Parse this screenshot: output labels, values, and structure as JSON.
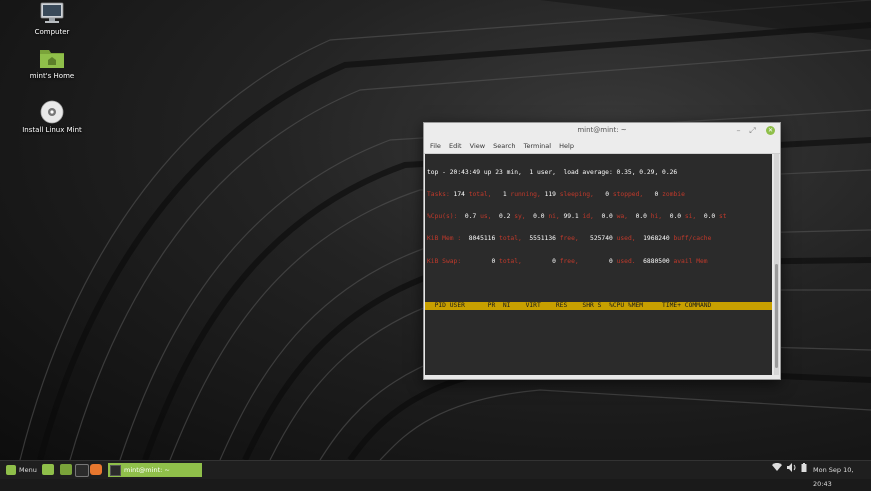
{
  "desktop": {
    "icons": [
      {
        "label": "Computer"
      },
      {
        "label": "mint's Home"
      },
      {
        "label": "Install Linux Mint"
      }
    ]
  },
  "window": {
    "title": "mint@mint: ~",
    "menu": [
      "File",
      "Edit",
      "View",
      "Search",
      "Terminal",
      "Help"
    ]
  },
  "terminal": {
    "line1": "top - 20:43:49 up 23 min,  1 user,  load average: 0.35, 0.29, 0.26",
    "tasks_total": "174",
    "tasks_running": "1",
    "tasks_sleeping": "119",
    "tasks_stopped": "0",
    "tasks_zombie": "0",
    "cpu_us": "0.7",
    "cpu_sy": "0.2",
    "cpu_ni": "0.0",
    "cpu_id": "99.1",
    "cpu_wa": "0.0",
    "cpu_hi": "0.0",
    "cpu_si": "0.0",
    "cpu_st": "0.0",
    "mem_total": "8045116",
    "mem_free": "5551136",
    "mem_used": "525740",
    "mem_buff": "1968240",
    "swap_total": "0",
    "swap_free": "0",
    "swap_avail": "6880500",
    "header": "  PID USER      PR  NI    VIRT    RES    SHR S  %CPU %MEM     TIME+ COMMAND     "
  },
  "taskbar": {
    "menu_label": "Menu",
    "active_task": "mint@mint: ~",
    "clock": "Mon Sep 10, 20:43"
  },
  "colors": {
    "accent": "#8fbf4a",
    "top_header": "#c8a000",
    "terminal_text": "#c0392b"
  }
}
